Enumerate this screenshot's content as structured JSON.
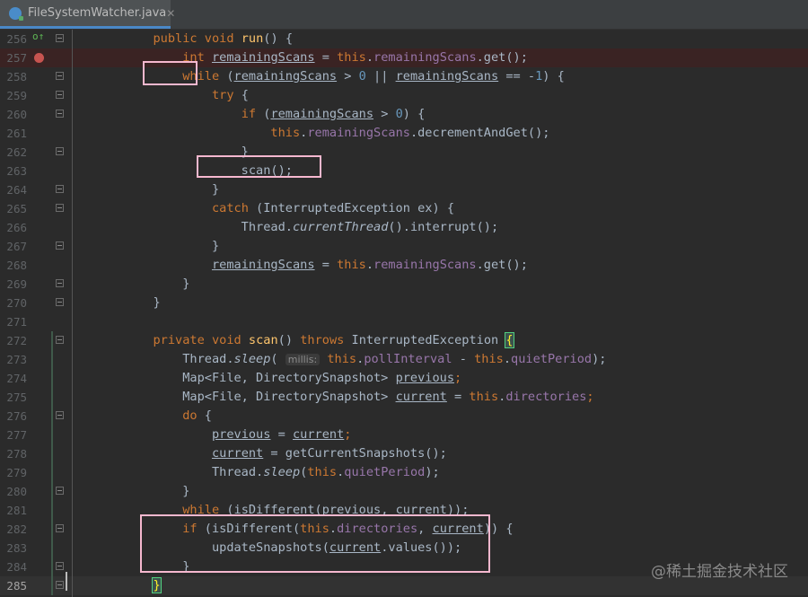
{
  "tab": {
    "filename": "FileSystemWatcher.java",
    "icon": "java-class-icon",
    "close": "✕"
  },
  "gutter": {
    "implements_marker": "o↑"
  },
  "lines": [
    {
      "n": "256",
      "tokens": [
        [
          "",
          "        "
        ],
        [
          "kw",
          "public"
        ],
        [
          "",
          " "
        ],
        [
          "kw",
          "void"
        ],
        [
          "",
          " "
        ],
        [
          "fn",
          "run"
        ],
        [
          "",
          "() {"
        ]
      ]
    },
    {
      "n": "257",
      "tokens": [
        [
          "",
          "            "
        ],
        [
          "kw",
          "int"
        ],
        [
          "",
          " "
        ],
        [
          "ul",
          "remainingScans"
        ],
        [
          "",
          " = "
        ],
        [
          "kw",
          "this"
        ],
        [
          "",
          "."
        ],
        [
          "fld",
          "remainingScans"
        ],
        [
          "",
          ".get();"
        ]
      ]
    },
    {
      "n": "258",
      "tokens": [
        [
          "",
          "            "
        ],
        [
          "kw",
          "while"
        ],
        [
          "",
          " ("
        ],
        [
          "ul",
          "remainingScans"
        ],
        [
          "",
          " > "
        ],
        [
          "num",
          "0"
        ],
        [
          "",
          " || "
        ],
        [
          "ul",
          "remainingScans"
        ],
        [
          "",
          " == -"
        ],
        [
          "num",
          "1"
        ],
        [
          "",
          ") {"
        ]
      ]
    },
    {
      "n": "259",
      "tokens": [
        [
          "",
          "                "
        ],
        [
          "kw",
          "try"
        ],
        [
          "",
          " {"
        ]
      ]
    },
    {
      "n": "260",
      "tokens": [
        [
          "",
          "                    "
        ],
        [
          "kw",
          "if"
        ],
        [
          "",
          " ("
        ],
        [
          "ul",
          "remainingScans"
        ],
        [
          "",
          " > "
        ],
        [
          "num",
          "0"
        ],
        [
          "",
          ") {"
        ]
      ]
    },
    {
      "n": "261",
      "tokens": [
        [
          "",
          "                        "
        ],
        [
          "kw",
          "this"
        ],
        [
          "",
          "."
        ],
        [
          "fld",
          "remainingScans"
        ],
        [
          "",
          ".decrementAndGet();"
        ]
      ]
    },
    {
      "n": "262",
      "tokens": [
        [
          "",
          "                    }"
        ]
      ]
    },
    {
      "n": "263",
      "tokens": [
        [
          "",
          "                    scan();"
        ]
      ]
    },
    {
      "n": "264",
      "tokens": [
        [
          "",
          "                }"
        ]
      ]
    },
    {
      "n": "265",
      "tokens": [
        [
          "",
          "                "
        ],
        [
          "kw",
          "catch"
        ],
        [
          "",
          " (InterruptedException ex) {"
        ]
      ]
    },
    {
      "n": "266",
      "tokens": [
        [
          "",
          "                    Thread."
        ],
        [
          "it",
          "currentThread"
        ],
        [
          "",
          "().interrupt();"
        ]
      ]
    },
    {
      "n": "267",
      "tokens": [
        [
          "",
          "                }"
        ]
      ]
    },
    {
      "n": "268",
      "tokens": [
        [
          "",
          "                "
        ],
        [
          "ul",
          "remainingScans"
        ],
        [
          "",
          " = "
        ],
        [
          "kw",
          "this"
        ],
        [
          "",
          "."
        ],
        [
          "fld",
          "remainingScans"
        ],
        [
          "",
          ".get();"
        ]
      ]
    },
    {
      "n": "269",
      "tokens": [
        [
          "",
          "            }"
        ]
      ]
    },
    {
      "n": "270",
      "tokens": [
        [
          "",
          "        }"
        ]
      ]
    },
    {
      "n": "271",
      "tokens": [
        [
          "",
          ""
        ]
      ]
    },
    {
      "n": "272",
      "tokens": [
        [
          "",
          "        "
        ],
        [
          "kw",
          "private"
        ],
        [
          "",
          " "
        ],
        [
          "kw",
          "void"
        ],
        [
          "",
          " "
        ],
        [
          "fn",
          "scan"
        ],
        [
          "",
          "() "
        ],
        [
          "kw",
          "throws"
        ],
        [
          "",
          " InterruptedException "
        ],
        [
          "matchbrace",
          "{"
        ]
      ]
    },
    {
      "n": "273",
      "tokens": [
        [
          "",
          "            Thread."
        ],
        [
          "it",
          "sleep"
        ],
        [
          "",
          "( "
        ],
        [
          "hint",
          "millis:"
        ],
        [
          "",
          " "
        ],
        [
          "kw",
          "this"
        ],
        [
          "",
          "."
        ],
        [
          "fld",
          "pollInterval"
        ],
        [
          "",
          " - "
        ],
        [
          "kw",
          "this"
        ],
        [
          "",
          "."
        ],
        [
          "fld",
          "quietPeriod"
        ],
        [
          "",
          ");"
        ]
      ]
    },
    {
      "n": "274",
      "tokens": [
        [
          "",
          "            Map<File, DirectorySnapshot> "
        ],
        [
          "ul",
          "previous"
        ],
        [
          "kw",
          ";"
        ]
      ]
    },
    {
      "n": "275",
      "tokens": [
        [
          "",
          "            Map<File, DirectorySnapshot> "
        ],
        [
          "ul",
          "current"
        ],
        [
          "",
          " = "
        ],
        [
          "kw",
          "this"
        ],
        [
          "",
          "."
        ],
        [
          "fld",
          "directories"
        ],
        [
          "kw",
          ";"
        ]
      ]
    },
    {
      "n": "276",
      "tokens": [
        [
          "",
          "            "
        ],
        [
          "kw",
          "do"
        ],
        [
          "",
          " {"
        ]
      ]
    },
    {
      "n": "277",
      "tokens": [
        [
          "",
          "                "
        ],
        [
          "ul",
          "previous"
        ],
        [
          "",
          " = "
        ],
        [
          "ul",
          "current"
        ],
        [
          "kw",
          ";"
        ]
      ]
    },
    {
      "n": "278",
      "tokens": [
        [
          "",
          "                "
        ],
        [
          "ul",
          "current"
        ],
        [
          "",
          " = getCurrentSnapshots();"
        ]
      ]
    },
    {
      "n": "279",
      "tokens": [
        [
          "",
          "                Thread."
        ],
        [
          "it",
          "sleep"
        ],
        [
          "",
          "("
        ],
        [
          "kw",
          "this"
        ],
        [
          "",
          "."
        ],
        [
          "fld",
          "quietPeriod"
        ],
        [
          "",
          ");"
        ]
      ]
    },
    {
      "n": "280",
      "tokens": [
        [
          "",
          "            }"
        ]
      ]
    },
    {
      "n": "281",
      "tokens": [
        [
          "",
          "            "
        ],
        [
          "kw",
          "while"
        ],
        [
          "",
          " (isDifferent("
        ],
        [
          "ul",
          "previous"
        ],
        [
          "",
          ", "
        ],
        [
          "ul",
          "current"
        ],
        [
          "",
          "));"
        ]
      ]
    },
    {
      "n": "282",
      "tokens": [
        [
          "",
          "            "
        ],
        [
          "kw",
          "if"
        ],
        [
          "",
          " (isDifferent("
        ],
        [
          "kw",
          "this"
        ],
        [
          "",
          "."
        ],
        [
          "fld",
          "directories"
        ],
        [
          "",
          ", "
        ],
        [
          "ul",
          "current"
        ],
        [
          "",
          ")) {"
        ]
      ]
    },
    {
      "n": "283",
      "tokens": [
        [
          "",
          "                updateSnapshots("
        ],
        [
          "ul",
          "current"
        ],
        [
          "",
          ".values());"
        ]
      ]
    },
    {
      "n": "284",
      "tokens": [
        [
          "",
          "            }"
        ]
      ]
    },
    {
      "n": "285",
      "tokens": [
        [
          "",
          "        "
        ],
        [
          "matchbrace",
          "}"
        ]
      ]
    }
  ],
  "watermark": "@稀土掘金技术社区",
  "colors": {
    "background": "#2b2b2b",
    "keyword": "#cc7832",
    "field": "#9876aa",
    "method": "#ffc66d",
    "number": "#6897bb",
    "text": "#a9b7c6",
    "highlight_box": "#f6b8cf",
    "breakpoint": "#c75450"
  }
}
